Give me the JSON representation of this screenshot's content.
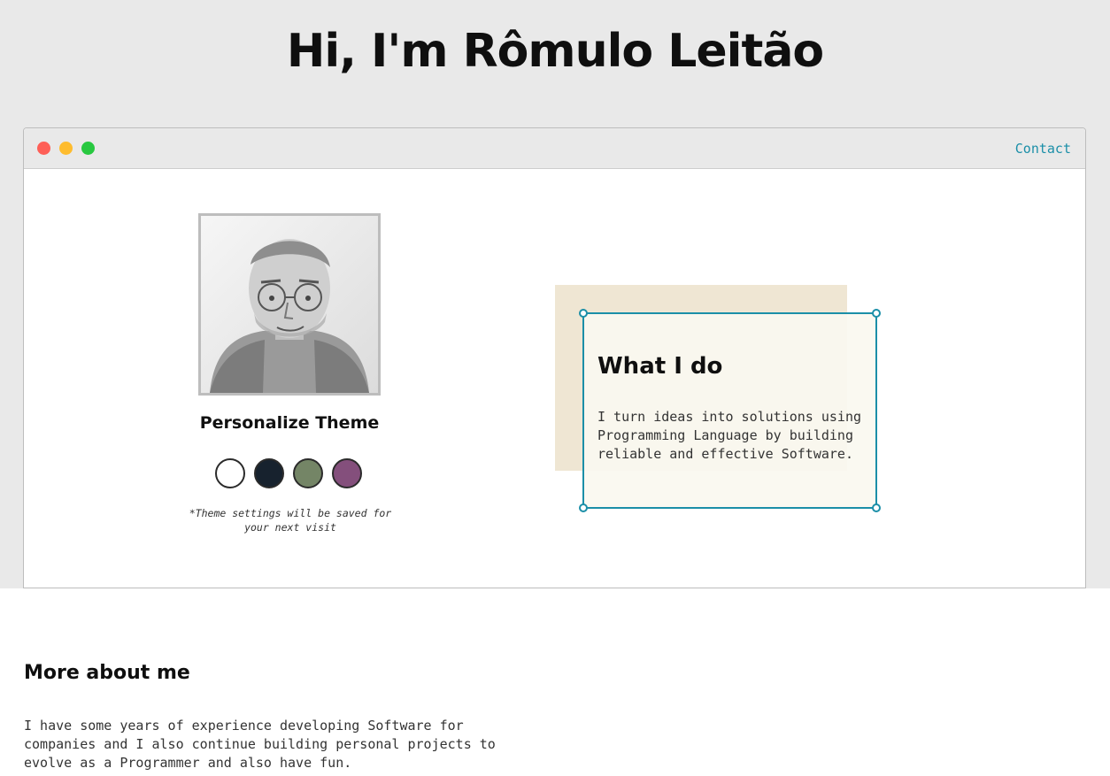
{
  "hero": {
    "title": "Hi, I'm Rômulo Leitão"
  },
  "window": {
    "contact_label": "Contact"
  },
  "profile": {
    "theme_title": "Personalize Theme",
    "theme_options": [
      {
        "name": "light",
        "color": "#ffffff"
      },
      {
        "name": "dark",
        "color": "#17222e"
      },
      {
        "name": "green",
        "color": "#748566"
      },
      {
        "name": "purple",
        "color": "#844f7c"
      }
    ],
    "theme_note": "*Theme settings will be saved for your next visit"
  },
  "what_i_do": {
    "title": "What I do",
    "text": "I turn ideas into solutions using Programming Language by building reliable and effective Software."
  },
  "about": {
    "title": "More about me",
    "text": "I have some years of experience developing Software for companies and I also continue building personal projects to evolve as a Programmer and also have fun."
  },
  "colors": {
    "page_band": "#e9e9e9",
    "accent": "#1b8fa8",
    "card_shadow": "#efe6d3",
    "window_red": "#fe5f57",
    "window_yellow": "#febc2e",
    "window_green": "#28c840"
  }
}
